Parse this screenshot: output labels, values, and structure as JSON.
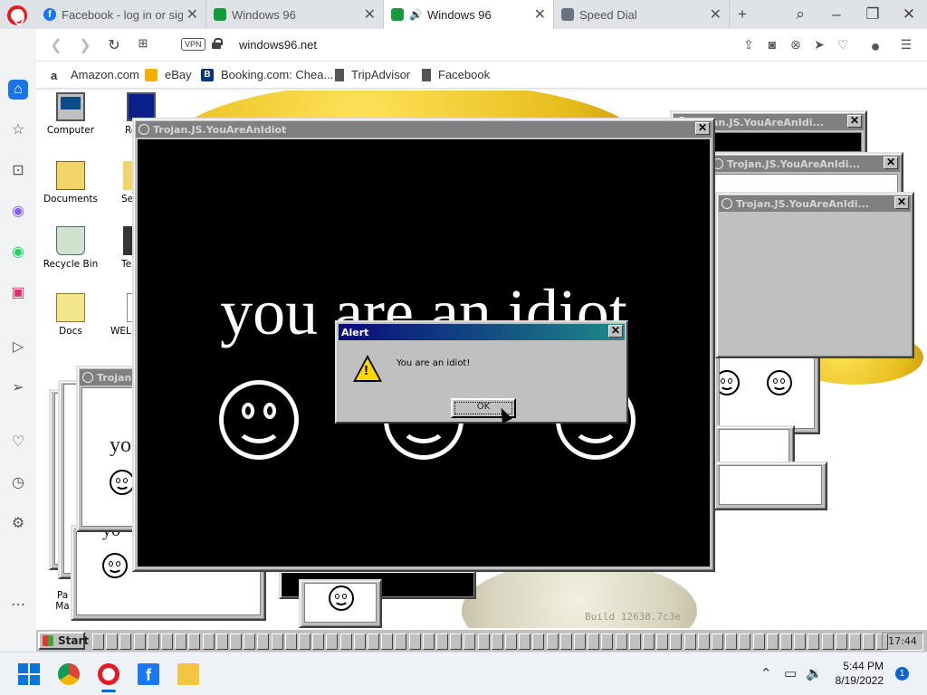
{
  "browser": {
    "tabs": [
      {
        "title": "Facebook - log in or sign",
        "favicon": "facebook-icon",
        "active": false
      },
      {
        "title": "Windows 96",
        "favicon": "win96-icon",
        "active": false
      },
      {
        "title": "Windows 96",
        "favicon": "win96-icon",
        "active": true,
        "audio": true
      },
      {
        "title": "Speed Dial",
        "favicon": "speed-dial-icon",
        "active": false
      }
    ],
    "new_tab_label": "+",
    "url": "windows96.net",
    "vpn_label": "VPN",
    "bookmarks": [
      {
        "label": "Amazon.com",
        "icon": "amazon-icon"
      },
      {
        "label": "eBay",
        "icon": "ebay-icon"
      },
      {
        "label": "Booking.com: Chea...",
        "icon": "booking-icon"
      },
      {
        "label": "TripAdvisor",
        "icon": "bookmark-icon"
      },
      {
        "label": "Facebook",
        "icon": "bookmark-icon"
      }
    ],
    "accent": "#e41b23"
  },
  "desktop": {
    "icons_col1": [
      {
        "label": "Computer",
        "icon": "computer-icon"
      },
      {
        "label": "Documents",
        "icon": "documents-folder-icon"
      },
      {
        "label": "Recycle Bin",
        "icon": "recycle-bin-icon"
      },
      {
        "label": "Docs",
        "icon": "folder-icon"
      }
    ],
    "icons_col2": [
      {
        "label": "Rep",
        "icon": "monitor-icon"
      },
      {
        "label": "Se",
        "icon": "shortcut-icon"
      },
      {
        "label": "Te",
        "icon": "shortcut-icon"
      },
      {
        "label": "WEL",
        "icon": "doc-icon"
      }
    ],
    "bottom_left_label": "Pa\nMa",
    "build_text": "Build 12638.7c3e"
  },
  "windows": {
    "main_title": "Trojan.JS.YouAreAnIdiot",
    "main_text": "you are an idiot",
    "bg_title_1": "Trojan.JS.YouAreAnIdi...",
    "bg_title_2": "Trojan.JS.YouAreAnIdi...",
    "bg_title_3": "Trojan.JS.YouAreAnIdi...",
    "left_title": "Trojan",
    "left_text": "you",
    "left_text2": "yo",
    "close_glyph": "✕"
  },
  "alert": {
    "title": "Alert",
    "message": "You are an idiot!",
    "ok_label": "OK"
  },
  "win96_taskbar": {
    "start_label": "Start",
    "clock": "17:44"
  },
  "os_taskbar": {
    "time": "5:44 PM",
    "date": "8/19/2022",
    "notification_count": "1"
  }
}
